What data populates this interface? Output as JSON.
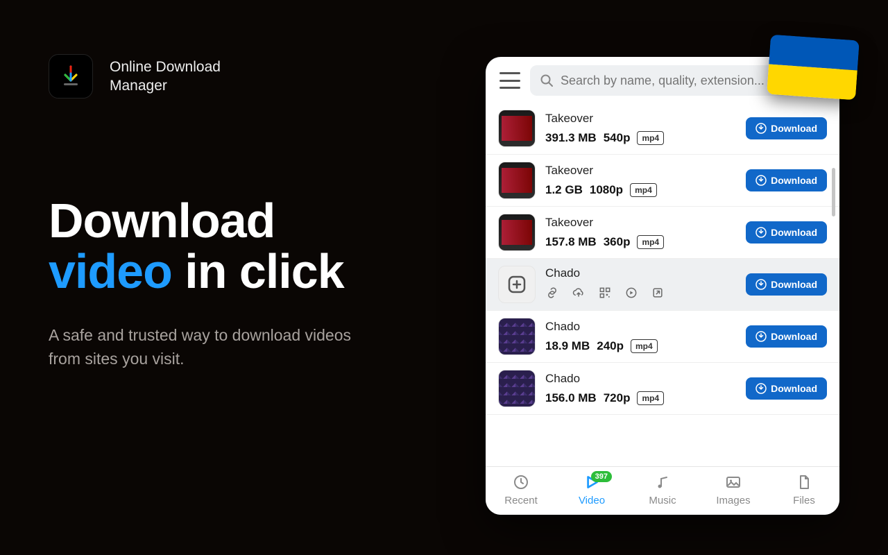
{
  "app": {
    "name_line1": "Online Download",
    "name_line2": "Manager"
  },
  "promo": {
    "headline_pre": "Download",
    "headline_accent": "video",
    "headline_post": " in click",
    "sub": "A safe and trusted way to download videos from sites you visit."
  },
  "search": {
    "placeholder": "Search by name, quality, extension..."
  },
  "download_label": "Download",
  "items": [
    {
      "title": "Takeover",
      "size": "391.3 MB",
      "quality": "540p",
      "ext": "mp4",
      "thumb": "movie"
    },
    {
      "title": "Takeover",
      "size": "1.2 GB",
      "quality": "1080p",
      "ext": "mp4",
      "thumb": "movie"
    },
    {
      "title": "Takeover",
      "size": "157.8 MB",
      "quality": "360p",
      "ext": "mp4",
      "thumb": "movie"
    },
    {
      "title": "Chado",
      "selected": true,
      "thumb": "plus"
    },
    {
      "title": "Chado",
      "size": "18.9 MB",
      "quality": "240p",
      "ext": "mp4",
      "thumb": "grid"
    },
    {
      "title": "Chado",
      "size": "156.0 MB",
      "quality": "720p",
      "ext": "mp4",
      "thumb": "grid"
    }
  ],
  "tabs": {
    "recent": "Recent",
    "video": "Video",
    "video_count": "397",
    "music": "Music",
    "images": "Images",
    "files": "Files"
  }
}
